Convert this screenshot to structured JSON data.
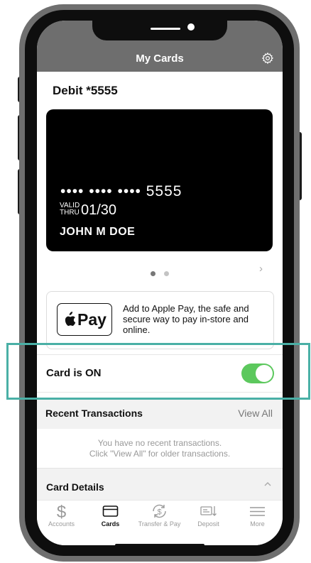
{
  "header": {
    "title": "My Cards"
  },
  "card": {
    "section_title": "Debit *5555",
    "masked_number": "•••• •••• •••• 5555",
    "valid_label_1": "VALID",
    "valid_label_2": "THRU",
    "expiry": "01/30",
    "holder": "JOHN M DOE",
    "pager_next": "›"
  },
  "apple_pay": {
    "badge": "Pay",
    "text": "Add to Apple Pay, the safe and secure way to pay in-store and online."
  },
  "card_toggle": {
    "label": "Card is ON",
    "state": "on"
  },
  "recent": {
    "title": "Recent Transactions",
    "view_all": "View All",
    "empty_line_1": "You have no recent transactions.",
    "empty_line_2": "Click \"View All\" for older transactions."
  },
  "card_details": {
    "title": "Card Details"
  },
  "tabs": [
    {
      "label": "Accounts",
      "icon": "dollar-icon"
    },
    {
      "label": "Cards",
      "icon": "card-icon",
      "active": true
    },
    {
      "label": "Transfer & Pay",
      "icon": "transfer-icon"
    },
    {
      "label": "Deposit",
      "icon": "check-deposit-icon"
    },
    {
      "label": "More",
      "icon": "menu-icon"
    }
  ],
  "colors": {
    "header_bg": "#6e6e6e",
    "toggle_on": "#5cc85d",
    "highlight": "#4ab0a6"
  }
}
